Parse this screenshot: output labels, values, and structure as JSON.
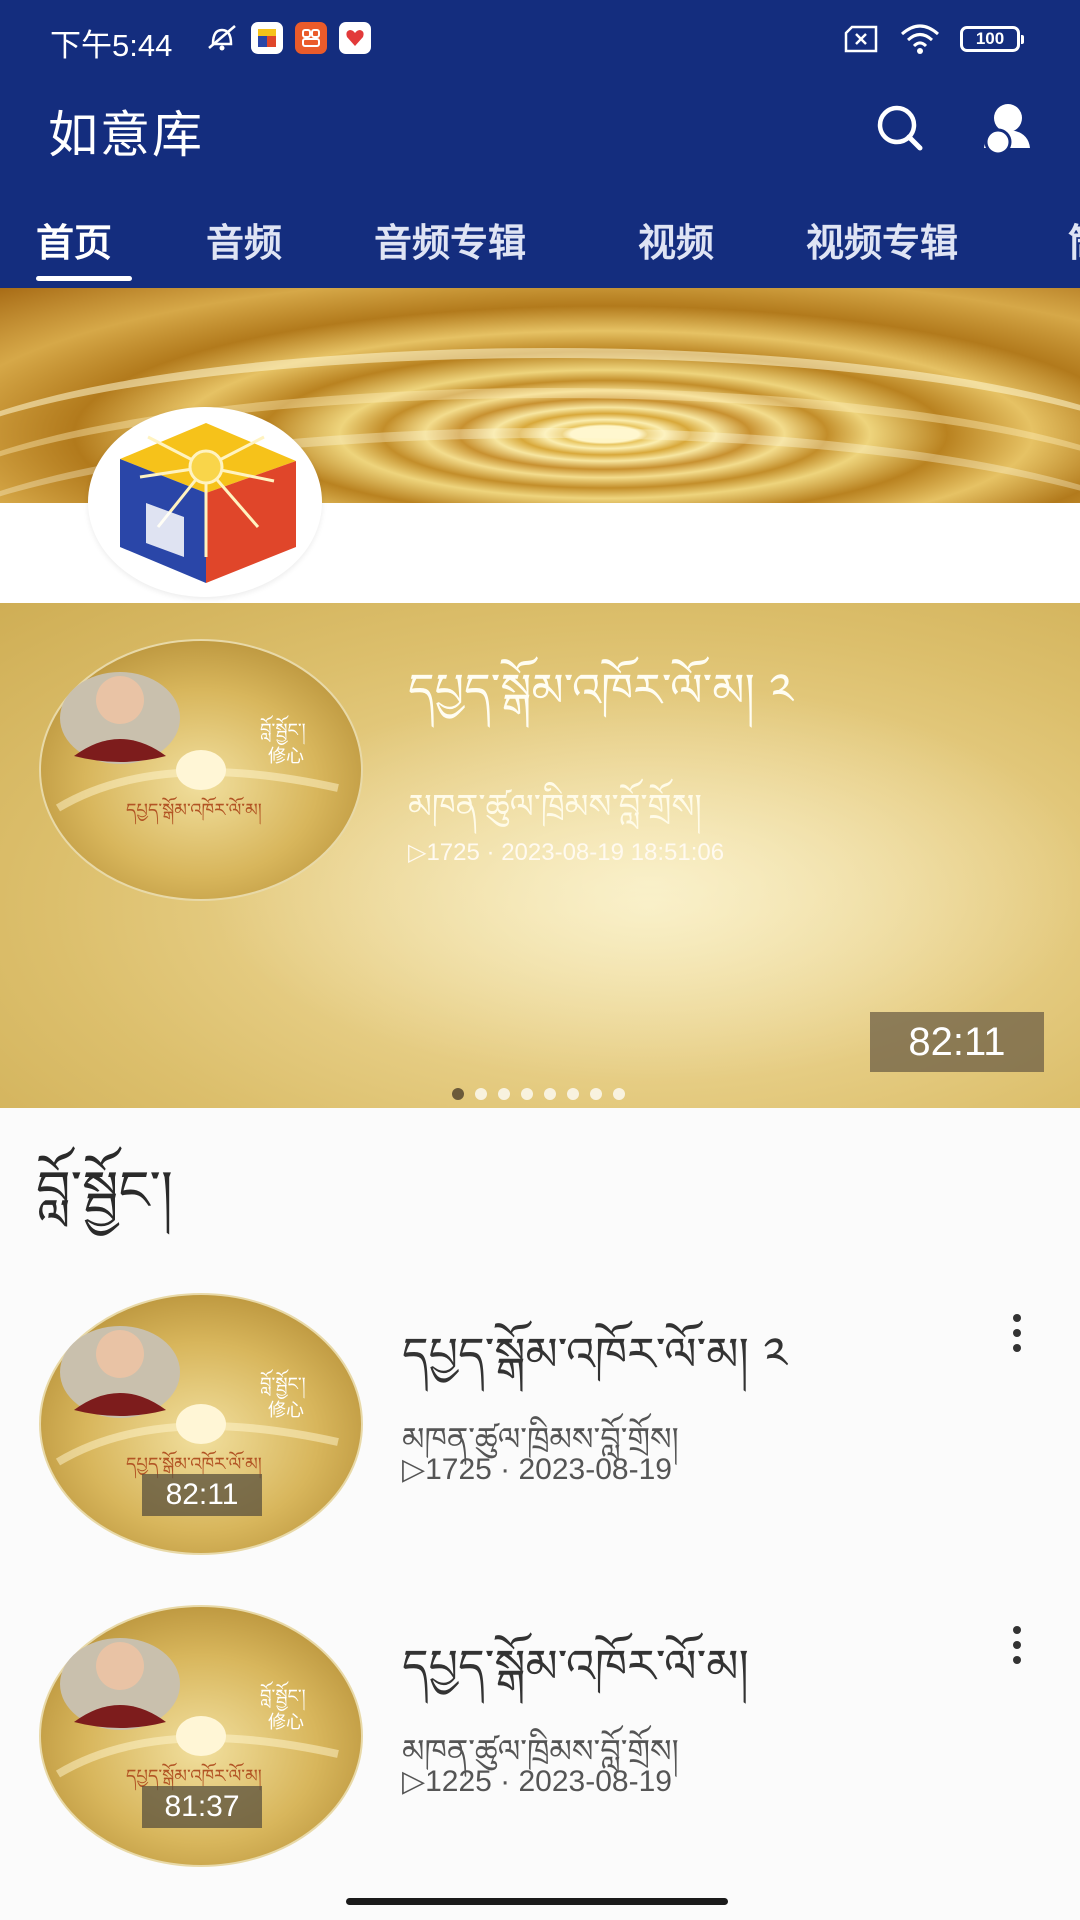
{
  "status_bar": {
    "time": "下午5:44",
    "battery": "100",
    "notification_icons": [
      "mute-icon",
      "app-notification-icon",
      "app-notification-icon",
      "app-notification-icon"
    ]
  },
  "app": {
    "title": "如意库"
  },
  "tabs": [
    {
      "label": "首页"
    },
    {
      "label": "音频"
    },
    {
      "label": "音频专辑"
    },
    {
      "label": "视频"
    },
    {
      "label": "视频专辑"
    },
    {
      "label": "筒"
    }
  ],
  "carousel": {
    "title": "དཔྱད་སྒོམ་འཁོར་ལོ་མ། ༢",
    "subtitle": "མཁན་ཚུལ་ཁྲིམས་བློ་གྲོས།",
    "play_count": "▷1725",
    "datetime": "2023-08-19 18:51:06",
    "duration": "82:11",
    "page_count": 8,
    "current_page": 1,
    "thumb_label_small": "བློ་སྦྱོང་།",
    "thumb_label_cn": "修心",
    "thumb_caption": "དཔྱད་སྒོམ་འཁོར་ལོ་མ།"
  },
  "section": {
    "title": "བློ་སྦྱོང་།"
  },
  "videos": [
    {
      "title": "དཔྱད་སྒོམ་འཁོར་ལོ་མ། ༢",
      "author": "མཁན་ཚུལ་ཁྲིམས་བློ་གྲོས།",
      "play_count": "▷1725",
      "date": "2023-08-19",
      "duration": "82:11"
    },
    {
      "title": "དཔྱད་སྒོམ་འཁོར་ལོ་མ།",
      "author": "མཁན་ཚུལ་ཁྲིམས་བློ་གྲོས།",
      "play_count": "▷1225",
      "date": "2023-08-19",
      "duration": "81:37"
    }
  ],
  "colors": {
    "header": "#142d7e",
    "gold": "#dcbf6c",
    "logo_blue": "#2a46a8",
    "logo_red": "#e0462a",
    "logo_yellow": "#f6c21a"
  }
}
